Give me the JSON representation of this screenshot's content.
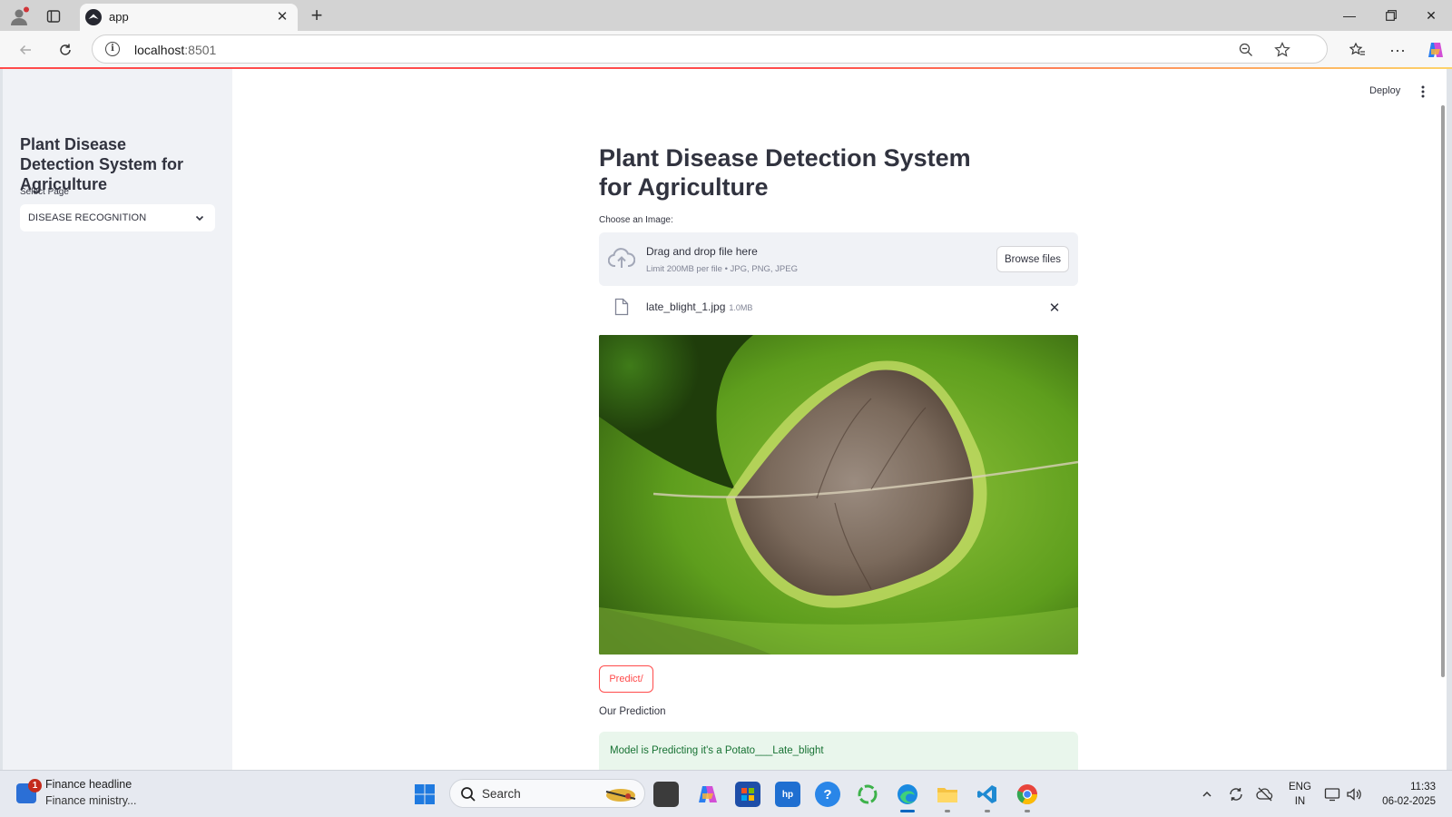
{
  "browser": {
    "tab_title": "app",
    "url_host": "localhost",
    "url_port": ":8501"
  },
  "app": {
    "deploy_label": "Deploy",
    "sidebar": {
      "title": "Plant Disease Detection System for Agriculture",
      "select_label": "Select Page",
      "select_value": "DISEASE RECOGNITION"
    },
    "main": {
      "title": "Plant Disease Detection System for Agriculture",
      "uploader_label": "Choose an Image:",
      "dropzone_text": "Drag and drop file here",
      "dropzone_limit": "Limit 200MB per file • JPG, PNG, JPEG",
      "browse_label": "Browse files",
      "file_name": "late_blight_1.jpg",
      "file_size": "1.0MB",
      "predict_label": "Predict/",
      "prediction_heading": "Our Prediction",
      "prediction_text": "Model is Predicting it's a Potato___Late_blight"
    }
  },
  "colors": {
    "primary": "#ff4b4b",
    "sidebar_bg": "#f0f2f6",
    "success_bg": "#e9f6ec",
    "success_text": "#177233"
  },
  "taskbar": {
    "news_badge": "1",
    "news_title": "Finance headline",
    "news_subtitle": "Finance ministry...",
    "search_placeholder": "Search",
    "lang_line1": "ENG",
    "lang_line2": "IN",
    "time": "11:33",
    "date": "06-02-2025"
  }
}
